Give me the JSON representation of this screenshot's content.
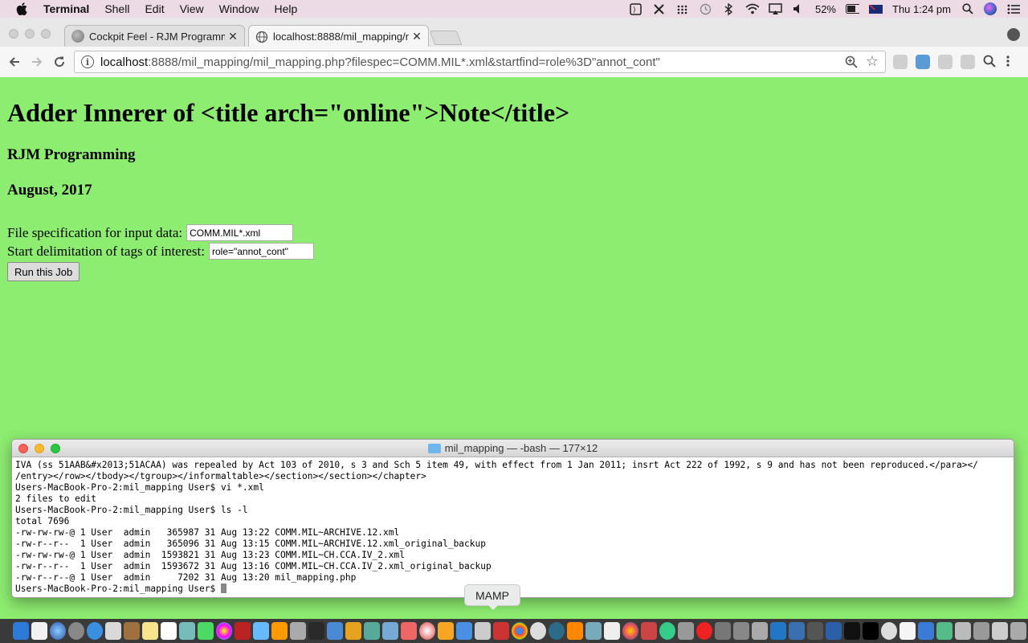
{
  "menubar": {
    "app": "Terminal",
    "items": [
      "Shell",
      "Edit",
      "View",
      "Window",
      "Help"
    ],
    "battery": "52%",
    "clock": "Thu 1:24 pm"
  },
  "browser": {
    "tabs": [
      {
        "label": "Cockpit Feel - RJM Programmi",
        "close": "✕"
      },
      {
        "label": "localhost:8888/mil_mapping/m",
        "close": "✕"
      }
    ],
    "url_host": "localhost",
    "url_rest": ":8888/mil_mapping/mil_mapping.php?filespec=COMM.MIL*.xml&startfind=role%3D\"annot_cont\""
  },
  "page": {
    "title": "Adder Innerer of <title arch=\"online\">Note</title>",
    "author": "RJM Programming",
    "date": "August, 2017",
    "filespec_label": "File specification for input data:",
    "filespec_value": "COMM.MIL*.xml",
    "startfind_label": "Start delimitation of tags of interest:",
    "startfind_value": "role=\"annot_cont\"",
    "run_button": "Run this Job"
  },
  "terminal": {
    "title": "mil_mapping — -bash — 177×12",
    "lines": [
      "IVA (ss 51AAB&#x2013;51ACAA) was repealed by Act 103 of 2010, s 3 and Sch 5 item 49, with effect from 1 Jan 2011; insrt Act 222 of 1992, s 9 and has not been reproduced.</para></",
      "/entry></row></tbody></tgroup></informaltable></section></section></chapter>",
      "Users-MacBook-Pro-2:mil_mapping User$ vi *.xml",
      "2 files to edit",
      "Users-MacBook-Pro-2:mil_mapping User$ ls -l",
      "total 7696",
      "-rw-rw-rw-@ 1 User  admin   365987 31 Aug 13:22 COMM.MIL~ARCHIVE.12.xml",
      "-rw-r--r--  1 User  admin   365096 31 Aug 13:15 COMM.MIL~ARCHIVE.12.xml_original_backup",
      "-rw-rw-rw-@ 1 User  admin  1593821 31 Aug 13:23 COMM.MIL~CH.CCA.IV_2.xml",
      "-rw-r--r--  1 User  admin  1593672 31 Aug 13:16 COMM.MIL~CH.CCA.IV_2.xml_original_backup",
      "-rw-r--r--@ 1 User  admin     7202 31 Aug 13:20 mil_mapping.php"
    ],
    "prompt": "Users-MacBook-Pro-2:mil_mapping User$ "
  },
  "dock": {
    "tooltip": "MAMP"
  }
}
